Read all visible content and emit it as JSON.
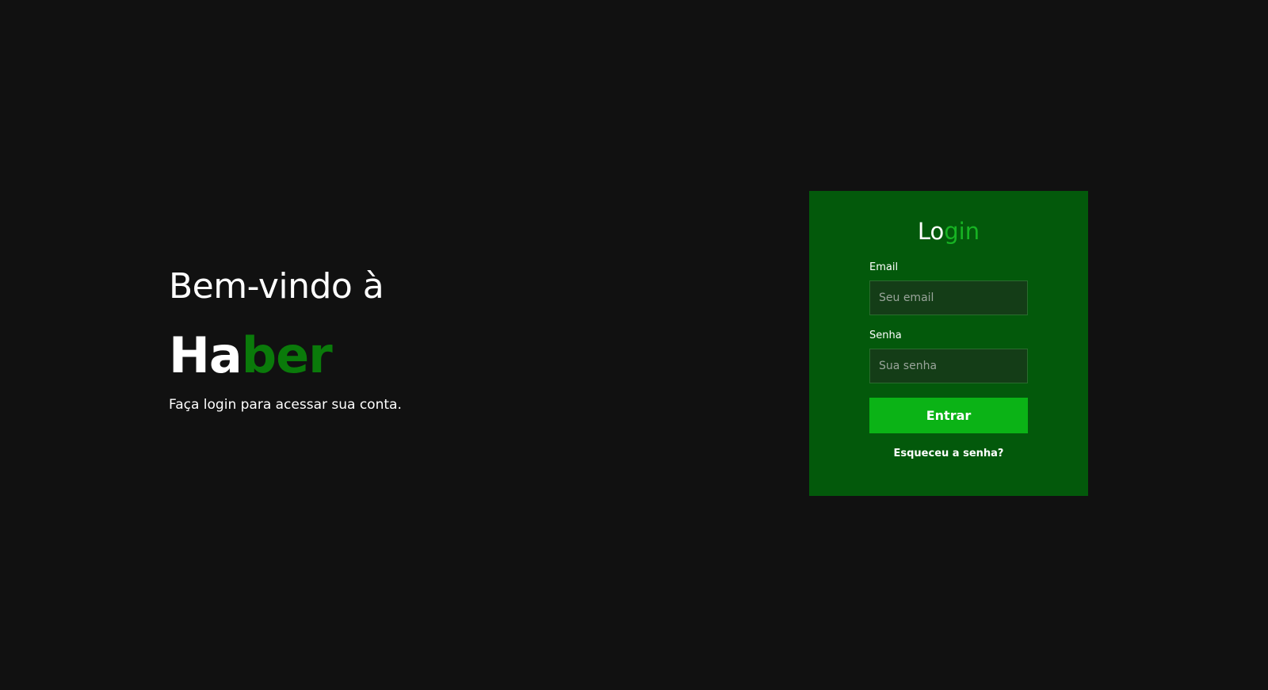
{
  "welcome": {
    "heading": "Bem-vindo à",
    "brand_part1": "Ha",
    "brand_part2": "ber",
    "subtitle": "Faça login para acessar sua conta."
  },
  "login": {
    "title_part1": "Lo",
    "title_part2": "gin",
    "email_label": "Email",
    "email_placeholder": "Seu email",
    "password_label": "Senha",
    "password_placeholder": "Sua senha",
    "submit_label": "Entrar",
    "forgot_label": "Esqueceu a senha?"
  },
  "colors": {
    "background": "#111111",
    "card": "#03590b",
    "brand_accent": "#0a7a0a",
    "title_accent": "#17b323",
    "button": "#0bb316",
    "input": "#143d17"
  }
}
